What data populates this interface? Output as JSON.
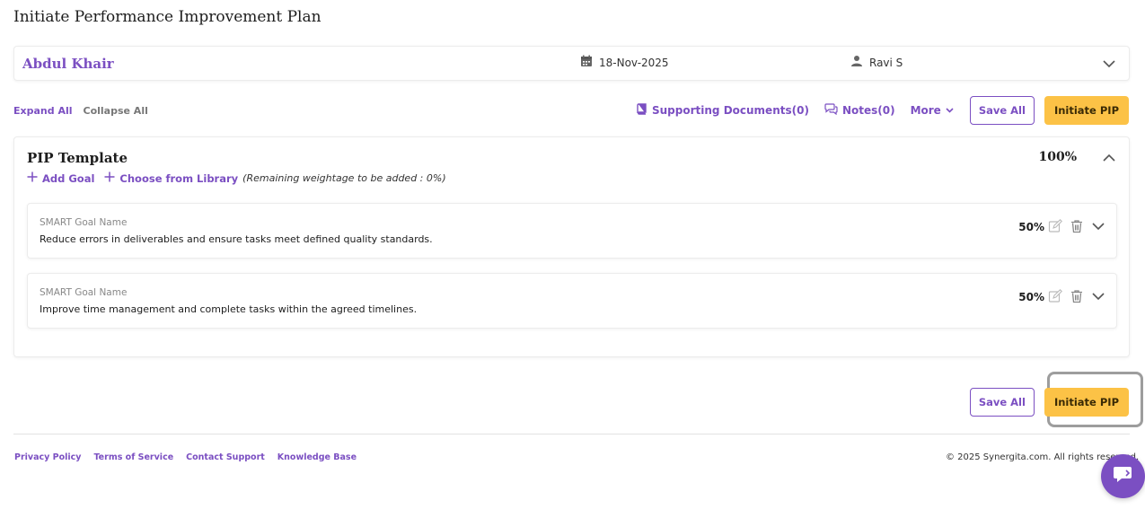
{
  "page": {
    "title": "Initiate Performance Improvement Plan"
  },
  "employee": {
    "name": "Abdul Khair",
    "date": "18-Nov-2025",
    "manager": "Ravi S"
  },
  "toolbar": {
    "expand_all": "Expand All",
    "collapse_all": "Collapse All",
    "supporting_docs": "Supporting Documents(0)",
    "notes": "Notes(0)",
    "more": "More",
    "save_all": "Save All",
    "initiate_pip": "Initiate PIP"
  },
  "template": {
    "title": "PIP Template",
    "weightage": "100%",
    "add_goal": "Add Goal",
    "choose_library": "Choose from Library",
    "remaining_note": "(Remaining weightage to be added : 0%)",
    "goals": [
      {
        "label": "SMART Goal Name",
        "text": "Reduce errors in deliverables and ensure tasks meet defined quality standards.",
        "weight": "50%"
      },
      {
        "label": "SMART Goal Name",
        "text": "Improve time management and complete tasks within the agreed timelines.",
        "weight": "50%"
      }
    ]
  },
  "bottom": {
    "save_all": "Save All",
    "initiate_pip": "Initiate PIP"
  },
  "footer": {
    "links": [
      "Privacy Policy",
      "Terms of Service",
      "Contact Support",
      "Knowledge Base"
    ],
    "copyright": "© 2025 Synergita.com. All rights reserved."
  },
  "colors": {
    "accent": "#7b4fc2",
    "primary_button": "#fcc246"
  },
  "icons": {
    "date": "calendar-icon",
    "manager": "user-icon",
    "docs": "book-icon",
    "notes": "chat-icon",
    "chat_fab": "chat-bubble-icon"
  }
}
